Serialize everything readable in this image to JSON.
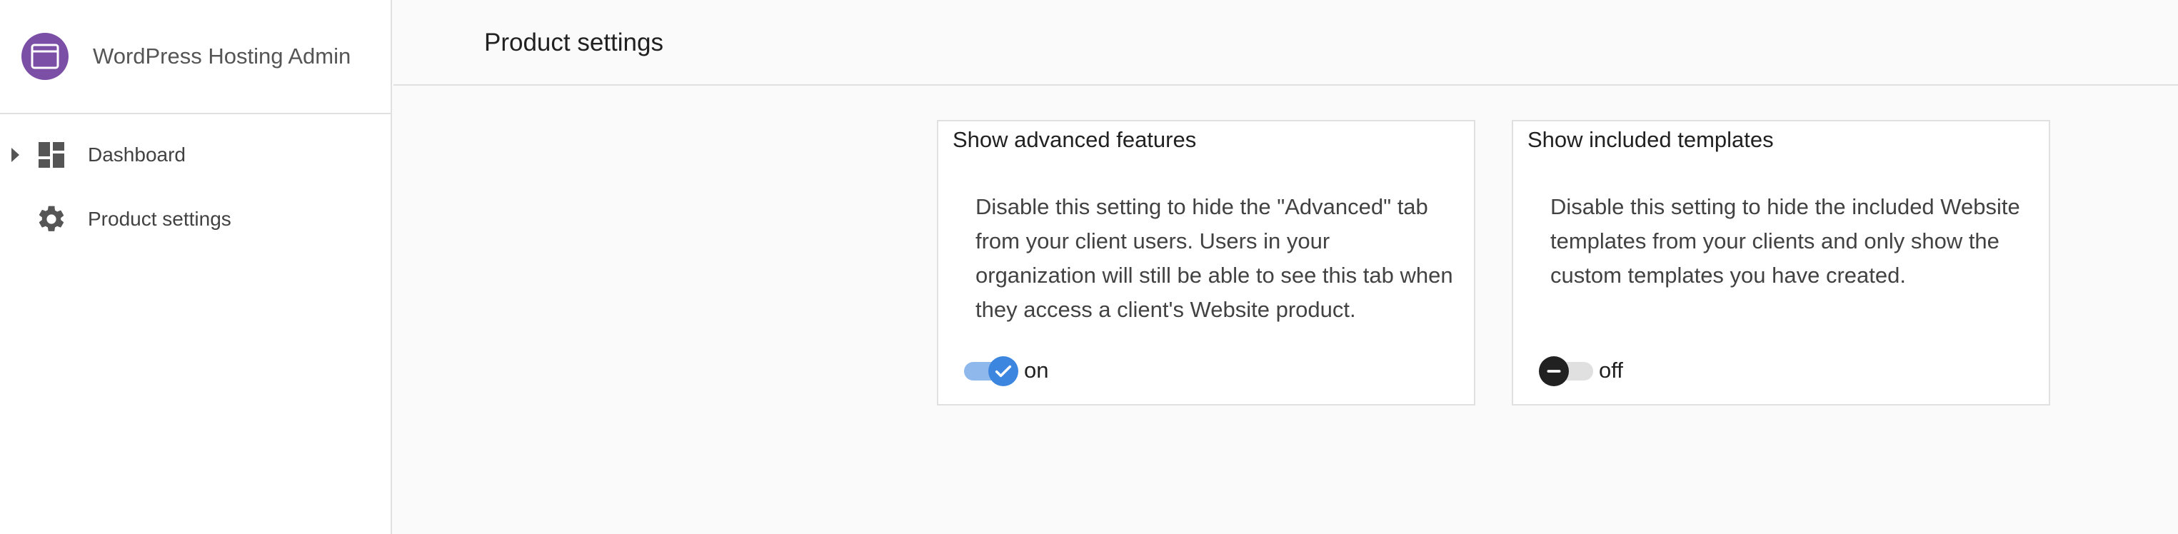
{
  "app": {
    "title": "WordPress Hosting Admin",
    "brand_color": "#7b4fa6",
    "logo_icon": "browser-window-icon"
  },
  "sidebar": {
    "items": [
      {
        "label": "Dashboard",
        "icon": "dashboard-icon",
        "expandable": true
      },
      {
        "label": "Product settings",
        "icon": "gear-icon",
        "expandable": false
      }
    ]
  },
  "header": {
    "title": "Product settings"
  },
  "settings": [
    {
      "title": "Show advanced features",
      "description": "Disable this setting to hide the \"Advanced\" tab from your client users. Users in your organization will still be able to see this tab when they access a client's Website product.",
      "state": "on",
      "state_label": "on",
      "color": "#3d86e0"
    },
    {
      "title": "Show included templates",
      "description": "Disable this setting to hide the included Website templates from your clients and only show the custom templates you have created.",
      "state": "off",
      "state_label": "off",
      "color": "#212121"
    }
  ]
}
